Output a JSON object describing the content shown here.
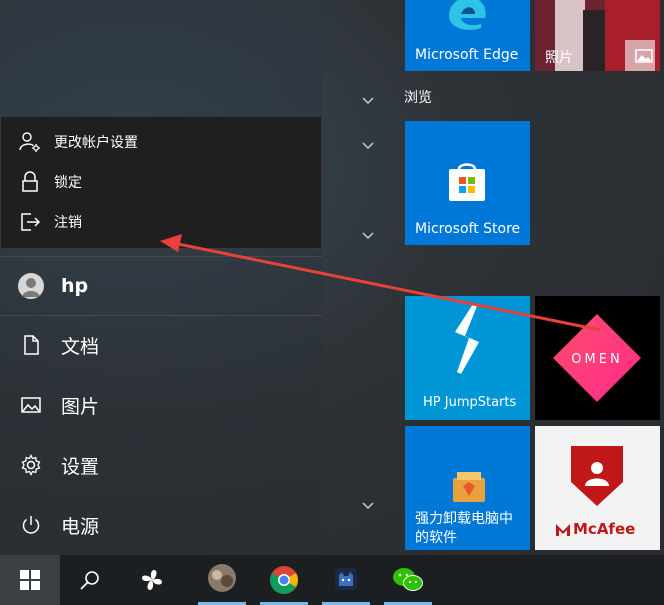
{
  "colors": {
    "accent": "#0078d7",
    "popup_bg": "#1f1f1f",
    "taskbar_bg": "#1c1f22",
    "arrow": "#e8413c",
    "omen_bg": "#000000",
    "mcafee_red": "#c01818"
  },
  "account_menu": {
    "items": [
      {
        "label": "更改帐户设置",
        "icon": "account-settings-icon"
      },
      {
        "label": "锁定",
        "icon": "lock-icon"
      },
      {
        "label": "注销",
        "icon": "sign-out-icon"
      }
    ]
  },
  "left_nav": {
    "user_name": "hp",
    "documents": "文档",
    "pictures": "图片",
    "settings": "设置",
    "power": "电源"
  },
  "tiles": {
    "group_browse": "浏览",
    "edge": "Microsoft Edge",
    "photos": "照片",
    "store": "Microsoft Store",
    "hp_jumpstarts": "HP JumpStarts",
    "omen": "OMEN",
    "uninstaller_line1": "强力卸载电脑中",
    "uninstaller_line2": "的软件",
    "mcafee": "McAfee"
  },
  "taskbar": {
    "icons": [
      "windows-start-icon",
      "search-icon",
      "pinwheel-app-icon",
      "photo-app-icon",
      "chrome-icon",
      "cat-app-icon",
      "wechat-icon"
    ]
  }
}
